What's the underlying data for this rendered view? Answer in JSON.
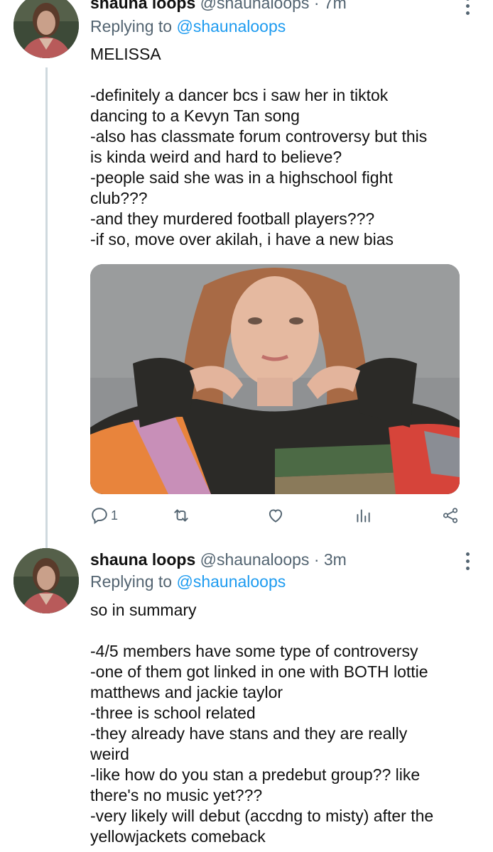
{
  "tweets": [
    {
      "name": "shauna loops",
      "handle": "@shaunaloops",
      "separator": "·",
      "time": "7m",
      "reply_prefix": "Replying to",
      "reply_to": "@shaunaloops",
      "lines": [
        "MELISSA",
        "",
        "-definitely a dancer bcs i saw her in tiktok",
        "dancing to a Kevyn Tan song",
        "-also has classmate forum controversy but this",
        "is kinda weird and hard to believe?",
        "-people said she was in a highschool fight",
        "club???",
        "-and they murdered football players???",
        "-if so, move over akilah, i have a new bias"
      ],
      "reply_count": "1",
      "icons": [
        "comment-icon",
        "retweet-icon",
        "like-icon",
        "analytics-icon",
        "share-icon"
      ]
    },
    {
      "name": "shauna loops",
      "handle": "@shaunaloops",
      "separator": "·",
      "time": "3m",
      "reply_prefix": "Replying to",
      "reply_to": "@shaunaloops",
      "lines": [
        "so in summary",
        "",
        "-4/5 members have some type of controversy",
        "-one of them got linked in one with BOTH lottie",
        "matthews and jackie taylor",
        "-three is school related",
        "-they already have stans and they are really",
        "weird",
        "-like how do you stan a predebut group?? like",
        "there's no music yet???",
        "-very likely will debut (accdng to misty) after the",
        "yellowjackets comeback"
      ]
    }
  ],
  "colors": {
    "link": "#1d9bf0",
    "secondary_text": "#536471",
    "thread_line": "#cfd9de"
  }
}
